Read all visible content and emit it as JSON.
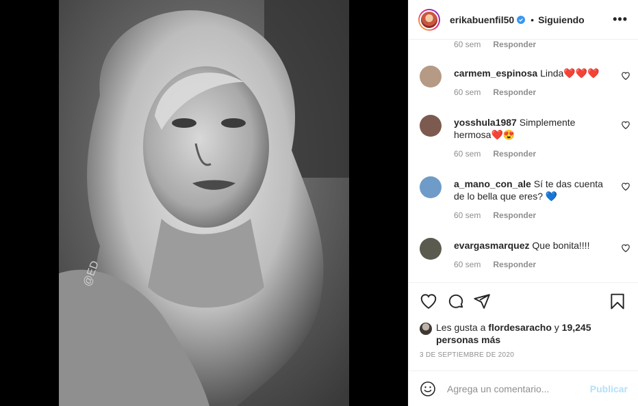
{
  "header": {
    "username": "erikabuenfil50",
    "separator": "•",
    "follow_status": "Siguiendo",
    "more_label": "•••"
  },
  "photo": {
    "watermark": "@ED"
  },
  "comments": {
    "top_meta": {
      "time": "60 sem",
      "reply": "Responder"
    },
    "items": [
      {
        "user": "carmem_espinosa",
        "text": "Linda❤️❤️❤️",
        "time": "60 sem",
        "reply": "Responder",
        "avatar_color": "#b59a86"
      },
      {
        "user": "yosshula1987",
        "text": "Simplemente hermosa❤️😍",
        "time": "60 sem",
        "reply": "Responder",
        "avatar_color": "#7d5a4f"
      },
      {
        "user": "a_mano_con_ale",
        "text": "Sí te das cuenta de lo bella que eres? 💙",
        "time": "60 sem",
        "reply": "Responder",
        "avatar_color": "#6f9bc8"
      },
      {
        "user": "evargasmarquez",
        "text": "Que bonita!!!!",
        "time": "60 sem",
        "reply": "Responder",
        "avatar_color": "#5b5a4e"
      }
    ]
  },
  "likes": {
    "prefix": "Les gusta a",
    "user": "flordesaracho",
    "joiner": "y",
    "count": "19,245 personas más"
  },
  "date": "3 DE SEPTIEMBRE DE 2020",
  "compose": {
    "placeholder": "Agrega un comentario...",
    "publish_label": "Publicar"
  },
  "colors": {
    "verified": "#3897f0",
    "publish_disabled": "#b2dffc",
    "secondary_text": "#8e8e8e"
  },
  "icons": [
    "verified-icon",
    "more-options-icon",
    "heart-icon",
    "comment-icon",
    "share-icon",
    "bookmark-icon",
    "emoji-icon"
  ]
}
